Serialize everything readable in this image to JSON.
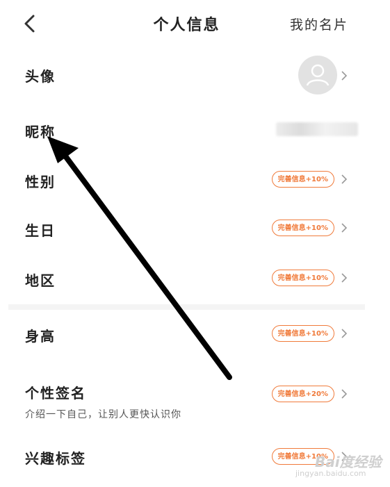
{
  "header": {
    "title": "个人信息",
    "my_card": "我的名片"
  },
  "rows_group1": [
    {
      "label": "头像"
    },
    {
      "label": "昵称"
    },
    {
      "label": "性别",
      "badge": "完善信息+10%"
    },
    {
      "label": "生日",
      "badge": "完善信息+10%"
    },
    {
      "label": "地区",
      "badge": "完善信息+10%"
    }
  ],
  "rows_group2": [
    {
      "label": "身高",
      "badge": "完善信息+10%"
    },
    {
      "label": "个性签名",
      "sub": "介绍一下自己，让别人更快认识你",
      "badge": "完善信息+20%"
    },
    {
      "label": "兴趣标签",
      "badge": "完善信息+10%"
    }
  ],
  "watermark": {
    "brand": "Bai度经验",
    "url": "jingyan.baidu.com"
  },
  "colors": {
    "accent": "#f07a3a",
    "background": "#f4f4f4",
    "annotation_arrow": "#000000"
  },
  "icons": [
    "back-arrow-icon",
    "avatar-placeholder-icon",
    "chevron-right-icon"
  ]
}
